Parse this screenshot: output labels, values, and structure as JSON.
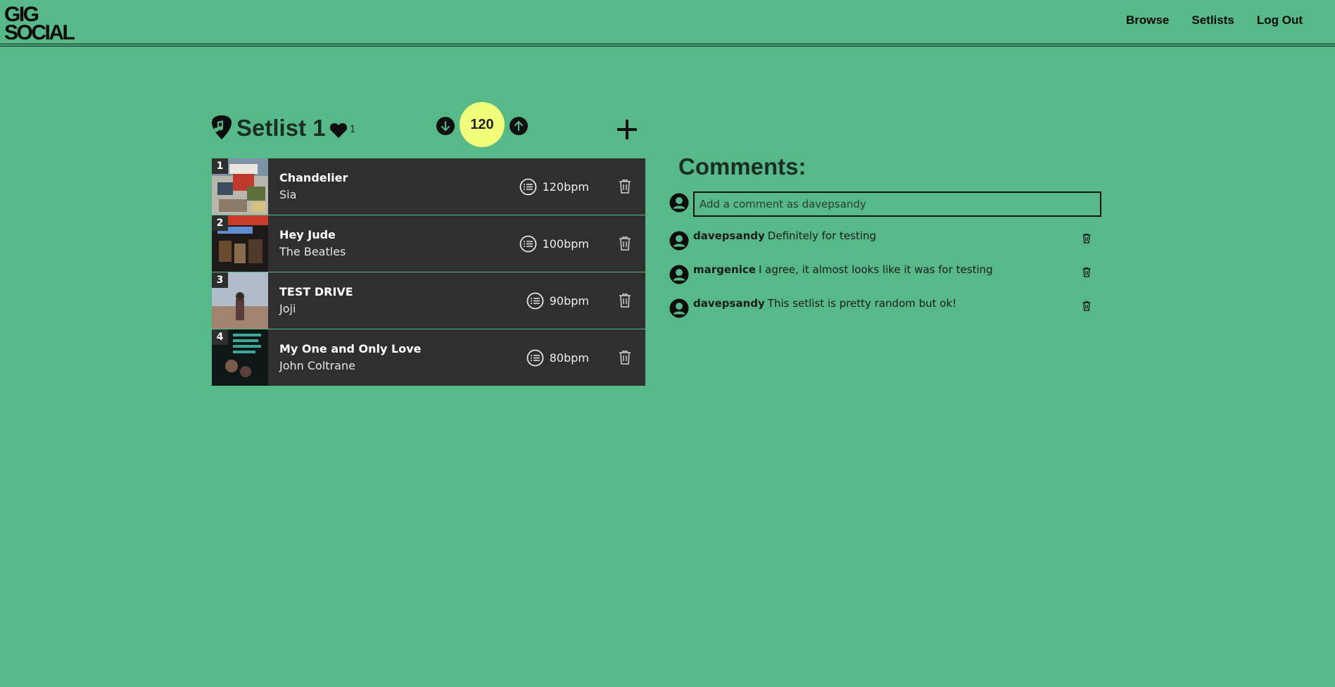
{
  "header": {
    "logo_line1": "GIG",
    "logo_line2": "SOCIAL",
    "nav": {
      "browse": "Browse",
      "setlists": "Setlists",
      "logout": "Log Out"
    }
  },
  "setlist": {
    "title": "Setlist 1",
    "likes": "1",
    "tempo": "120",
    "icons": {
      "pick": "guitar-pick-music-icon",
      "like": "heart-icon",
      "down": "arrow-down-icon",
      "up": "arrow-up-icon",
      "add": "plus-icon"
    }
  },
  "songs": [
    {
      "index": "1",
      "title": "Chandelier",
      "artist": "Sia",
      "bpm": "120bpm"
    },
    {
      "index": "2",
      "title": "Hey Jude",
      "artist": "The Beatles",
      "bpm": "100bpm"
    },
    {
      "index": "3",
      "title": "TEST DRIVE",
      "artist": "Joji",
      "bpm": "90bpm"
    },
    {
      "index": "4",
      "title": "My One and Only Love",
      "artist": "John Coltrane",
      "bpm": "80bpm"
    }
  ],
  "comments": {
    "heading": "Comments:",
    "input_placeholder": "Add a comment as davepsandy",
    "items": [
      {
        "user": "davepsandy",
        "text": "Definitely for testing"
      },
      {
        "user": "margenice",
        "text": "I agree, it almost looks like it was for testing"
      },
      {
        "user": "davepsandy",
        "text": "This setlist is pretty random but ok!"
      }
    ]
  },
  "colors": {
    "background": "#57b888",
    "row": "#2f2f2f",
    "tempo": "#f0fd7a"
  }
}
